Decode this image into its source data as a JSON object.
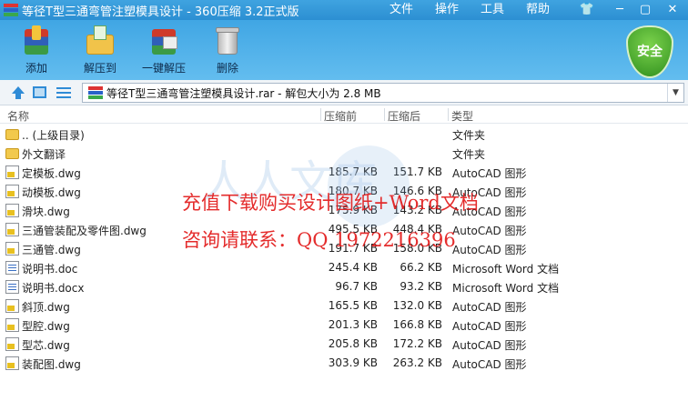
{
  "window": {
    "title": "等径T型三通弯管注塑模具设计 - 360压缩 3.2正式版",
    "menu": [
      "文件",
      "操作",
      "工具",
      "帮助"
    ]
  },
  "toolbar": {
    "items": [
      {
        "label": "添加",
        "icon": "add-archive-icon"
      },
      {
        "label": "解压到",
        "icon": "extract-to-icon"
      },
      {
        "label": "一键解压",
        "icon": "one-click-extract-icon"
      },
      {
        "label": "删除",
        "icon": "delete-trash-icon"
      }
    ],
    "security_label": "安全"
  },
  "address": {
    "path": "等径T型三通弯管注塑模具设计.rar - 解包大小为 2.8 MB"
  },
  "columns": {
    "name": "名称",
    "compressed_size": "压缩前",
    "uncompressed_size": "压缩后",
    "type": "类型"
  },
  "files": [
    {
      "name": ".. (上级目录)",
      "csize": "",
      "usize": "",
      "type": "文件夹",
      "icon": "folder"
    },
    {
      "name": "外文翻译",
      "csize": "",
      "usize": "",
      "type": "文件夹",
      "icon": "folder"
    },
    {
      "name": "定模板.dwg",
      "csize": "185.7 KB",
      "usize": "151.7 KB",
      "type": "AutoCAD 图形",
      "icon": "dwg"
    },
    {
      "name": "动模板.dwg",
      "csize": "180.7 KB",
      "usize": "146.6 KB",
      "type": "AutoCAD 图形",
      "icon": "dwg"
    },
    {
      "name": "滑块.dwg",
      "csize": "175.9 KB",
      "usize": "143.2 KB",
      "type": "AutoCAD 图形",
      "icon": "dwg"
    },
    {
      "name": "三通管装配及零件图.dwg",
      "csize": "495.5 KB",
      "usize": "448.4 KB",
      "type": "AutoCAD 图形",
      "icon": "dwg"
    },
    {
      "name": "三通管.dwg",
      "csize": "191.7 KB",
      "usize": "158.0 KB",
      "type": "AutoCAD 图形",
      "icon": "dwg"
    },
    {
      "name": "说明书.doc",
      "csize": "245.4 KB",
      "usize": "66.2 KB",
      "type": "Microsoft Word 文档",
      "icon": "doc"
    },
    {
      "name": "说明书.docx",
      "csize": "96.7 KB",
      "usize": "93.2 KB",
      "type": "Microsoft Word 文档",
      "icon": "doc"
    },
    {
      "name": "斜顶.dwg",
      "csize": "165.5 KB",
      "usize": "132.0 KB",
      "type": "AutoCAD 图形",
      "icon": "dwg"
    },
    {
      "name": "型腔.dwg",
      "csize": "201.3 KB",
      "usize": "166.8 KB",
      "type": "AutoCAD 图形",
      "icon": "dwg"
    },
    {
      "name": "型芯.dwg",
      "csize": "205.8 KB",
      "usize": "172.2 KB",
      "type": "AutoCAD 图形",
      "icon": "dwg"
    },
    {
      "name": "装配图.dwg",
      "csize": "303.9 KB",
      "usize": "263.2 KB",
      "type": "AutoCAD 图形",
      "icon": "dwg"
    }
  ],
  "watermark": {
    "line1": "充值下载购买设计图纸+Word文档",
    "line2": "咨询请联系：QQ 1972216396",
    "logo": "人人文库"
  },
  "colors": {
    "titlebar": "#2c8fd2",
    "toolbar": "#40a6e4",
    "security_shield": "#3a9a22",
    "watermark_text": "#e21b1b"
  }
}
